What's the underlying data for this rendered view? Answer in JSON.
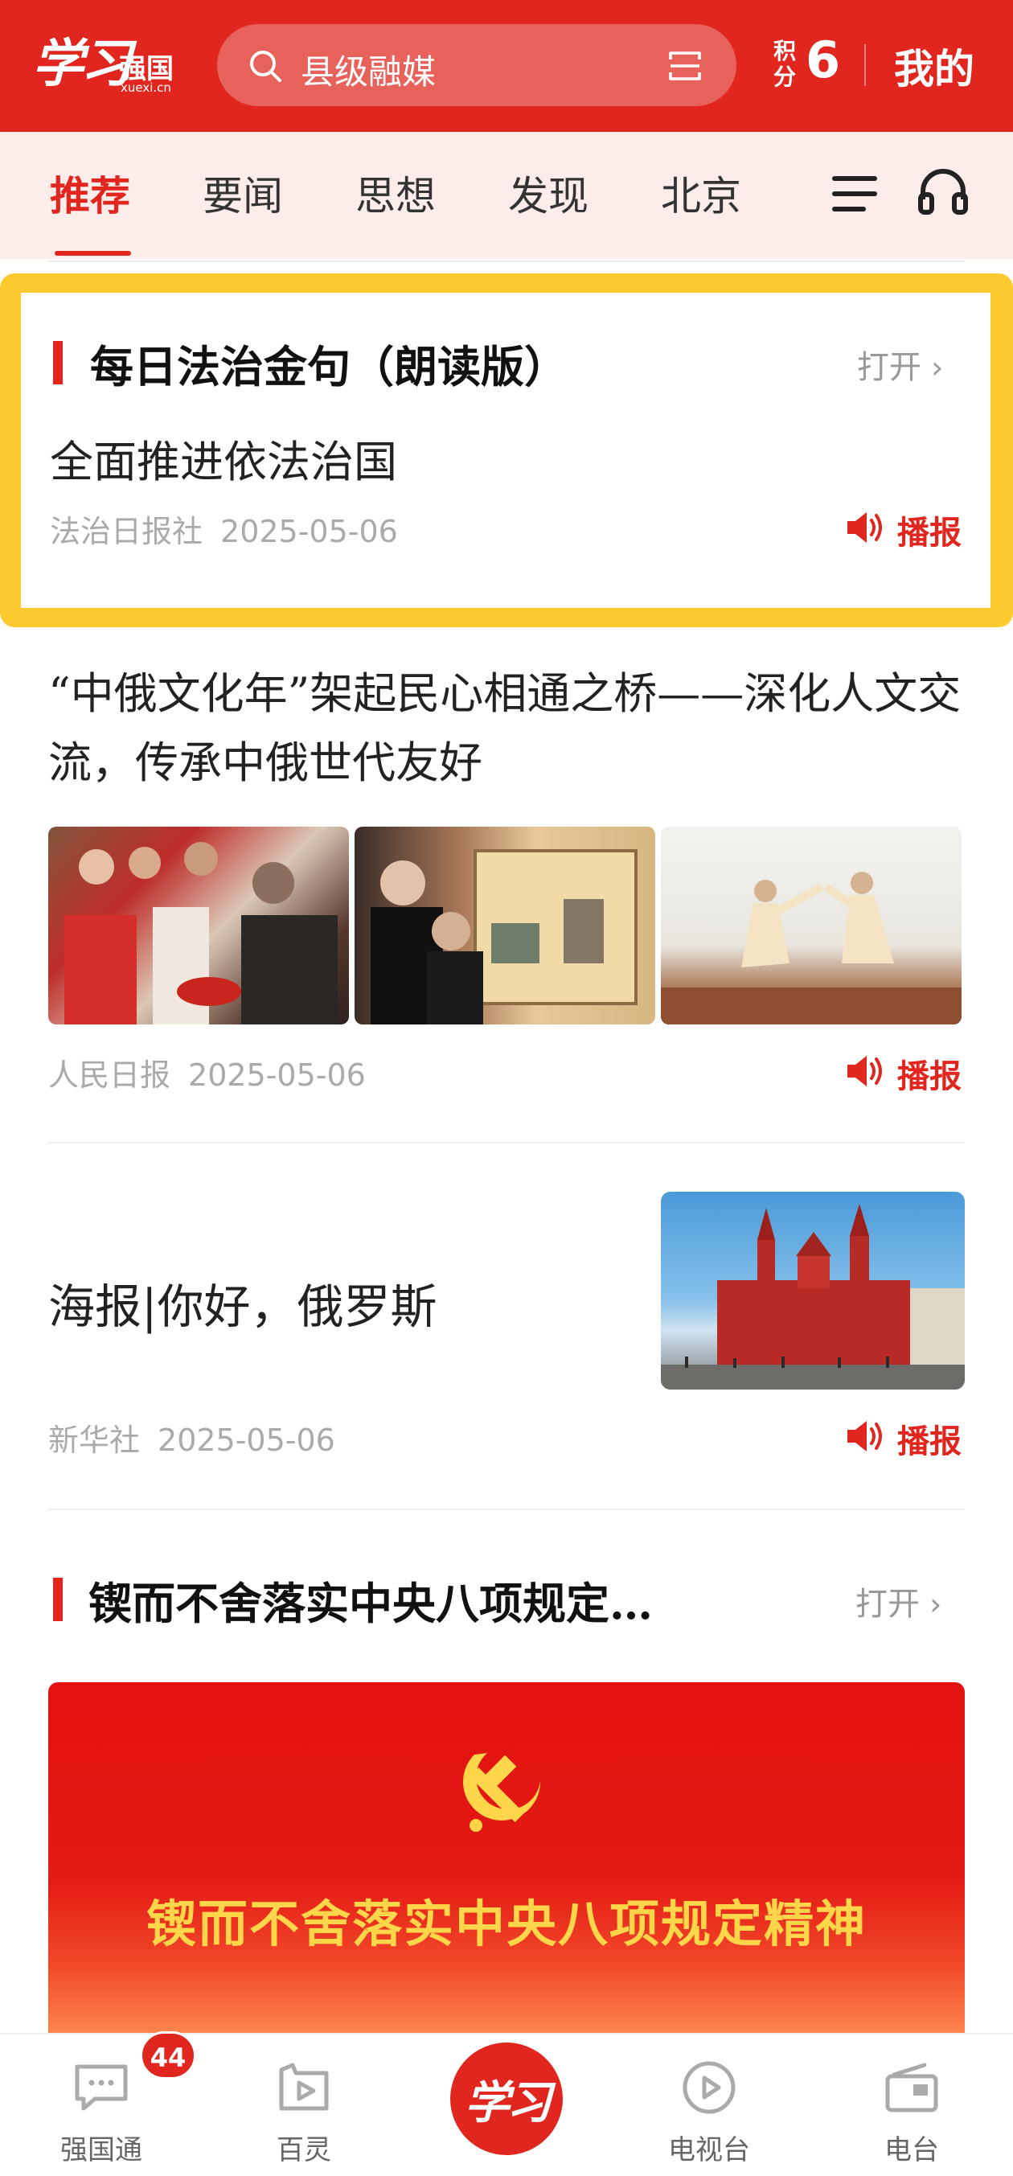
{
  "header": {
    "logo_main": "学习",
    "logo_sub": "强国",
    "logo_domain": "xuexi.cn",
    "search_placeholder": "县级融媒",
    "points_label": "积分",
    "points_value": "6",
    "mine_label": "我的"
  },
  "tabs": [
    {
      "label": "推荐",
      "active": true
    },
    {
      "label": "要闻",
      "active": false
    },
    {
      "label": "思想",
      "active": false
    },
    {
      "label": "发现",
      "active": false
    },
    {
      "label": "北京",
      "active": false
    }
  ],
  "highlight_card": {
    "section_title": "每日法治金句（朗读版）",
    "open_label": "打开",
    "headline": "全面推进依法治国",
    "source": "法治日报社",
    "date": "2025-05-06",
    "play_label": "播报"
  },
  "article1": {
    "title": "“中俄文化年”架起民心相通之桥——深化人文交流，传承中俄世代友好",
    "source": "人民日报",
    "date": "2025-05-06",
    "play_label": "播报"
  },
  "article2": {
    "title": "海报|你好，俄罗斯",
    "source": "新华社",
    "date": "2025-05-06",
    "play_label": "播报"
  },
  "section2": {
    "title": "锲而不舍落实中央八项规定…",
    "open_label": "打开",
    "banner_text": "锲而不舍落实中央八项规定精神"
  },
  "bottom_nav": {
    "items": [
      {
        "label": "强国通",
        "icon": "chat-icon",
        "badge": "44"
      },
      {
        "label": "百灵",
        "icon": "video-play-icon"
      },
      {
        "label": "学习",
        "icon": "xuexi-logo-icon"
      },
      {
        "label": "电视台",
        "icon": "tv-play-icon"
      },
      {
        "label": "电台",
        "icon": "radio-icon"
      }
    ]
  },
  "colors": {
    "brand_red": "#e0261e",
    "highlight_yellow": "#fcca2e",
    "banner_gold": "#ffd54a"
  }
}
